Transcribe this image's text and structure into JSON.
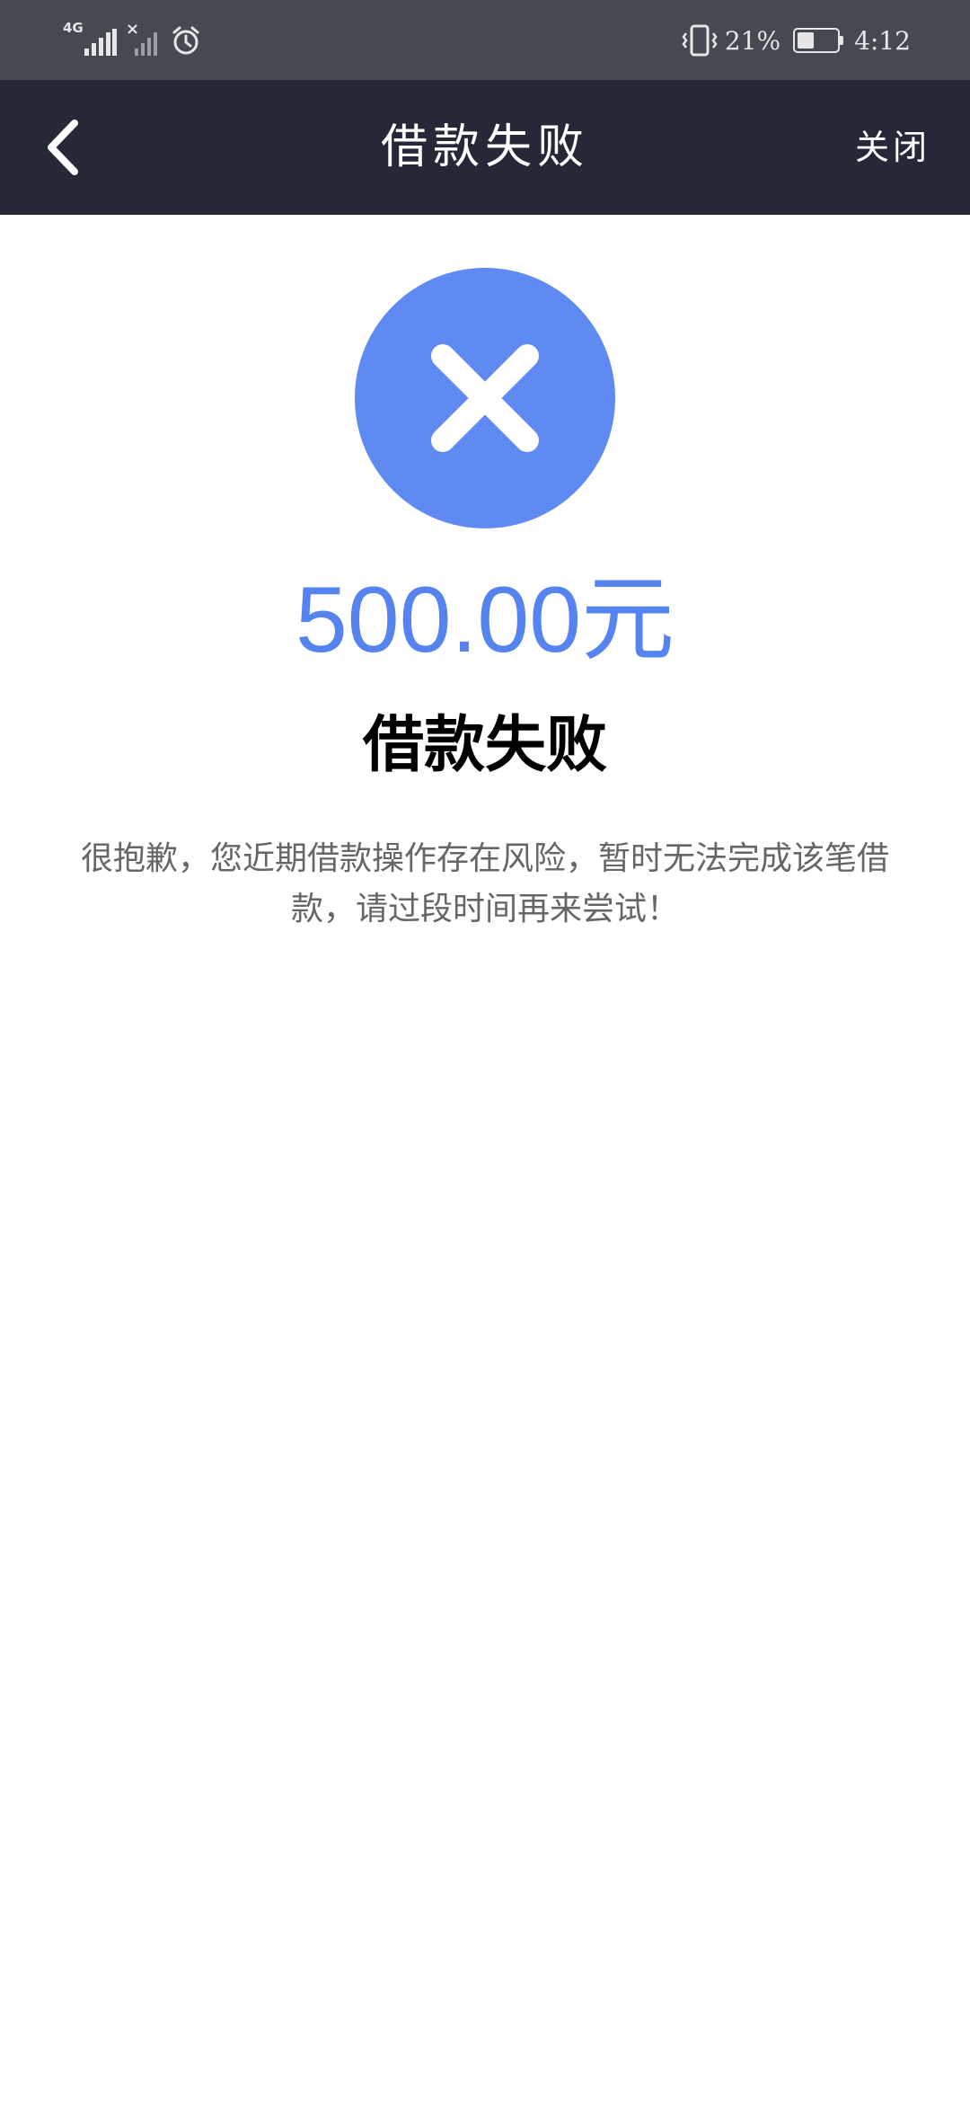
{
  "status_bar": {
    "network_type": "4G",
    "battery_percent": "21%",
    "battery_level": 0.21,
    "time": "4:12",
    "icons": [
      "signal-icon",
      "no-signal-icon",
      "alarm-icon",
      "vibrate-icon",
      "battery-icon"
    ]
  },
  "nav": {
    "back_icon": "chevron-left-icon",
    "title": "借款失败",
    "close_label": "关闭"
  },
  "result": {
    "icon": "close-circle-icon",
    "amount": "500.00元",
    "title": "借款失败",
    "message": "很抱歉，您近期借款操作存在风险，暂时无法完成该笔借款，请过段时间再来尝试！"
  },
  "colors": {
    "status_bar_bg": "#454a52",
    "nav_bg": "#252937",
    "accent": "#5583f0",
    "icon_bg": "#5e8af2",
    "message_text": "#666666"
  }
}
